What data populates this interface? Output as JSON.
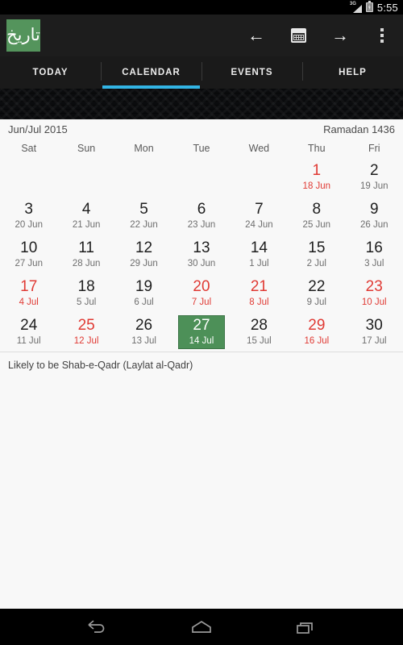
{
  "status_bar": {
    "network": "3G",
    "signal_icon": "signal-bars-icon",
    "battery_icon": "battery-charging-icon",
    "time": "5:55"
  },
  "action_bar": {
    "app_logo_text": "تاریخ",
    "app_logo_color": "#54945c",
    "buttons": [
      {
        "name": "previous-month-button",
        "glyph": "←"
      },
      {
        "name": "month-view-button",
        "glyph": "calendar-icon"
      },
      {
        "name": "next-month-button",
        "glyph": "→"
      },
      {
        "name": "overflow-menu-button",
        "glyph": "⋮"
      }
    ]
  },
  "tabs": {
    "active_index": 1,
    "accent_color": "#33b5e5",
    "items": [
      {
        "label": "TODAY"
      },
      {
        "label": "CALENDAR"
      },
      {
        "label": "EVENTS"
      },
      {
        "label": "HELP"
      }
    ]
  },
  "calendar": {
    "gregorian_range": "Jun/Jul 2015",
    "hijri_month": "Ramadan 1436",
    "weekday_headers": [
      "Sat",
      "Sun",
      "Mon",
      "Tue",
      "Wed",
      "Thu",
      "Fri"
    ],
    "selected_color": "#4d9058",
    "holiday_color": "#e03a34",
    "weeks": [
      [
        {
          "hijri": "",
          "greg": "",
          "empty": true
        },
        {
          "hijri": "",
          "greg": "",
          "empty": true
        },
        {
          "hijri": "",
          "greg": "",
          "empty": true
        },
        {
          "hijri": "",
          "greg": "",
          "empty": true
        },
        {
          "hijri": "",
          "greg": "",
          "empty": true
        },
        {
          "hijri": "1",
          "greg": "18 Jun",
          "holiday": true
        },
        {
          "hijri": "2",
          "greg": "19 Jun"
        }
      ],
      [
        {
          "hijri": "3",
          "greg": "20 Jun"
        },
        {
          "hijri": "4",
          "greg": "21 Jun"
        },
        {
          "hijri": "5",
          "greg": "22 Jun"
        },
        {
          "hijri": "6",
          "greg": "23 Jun"
        },
        {
          "hijri": "7",
          "greg": "24 Jun"
        },
        {
          "hijri": "8",
          "greg": "25 Jun"
        },
        {
          "hijri": "9",
          "greg": "26 Jun"
        }
      ],
      [
        {
          "hijri": "10",
          "greg": "27 Jun"
        },
        {
          "hijri": "11",
          "greg": "28 Jun"
        },
        {
          "hijri": "12",
          "greg": "29 Jun"
        },
        {
          "hijri": "13",
          "greg": "30 Jun"
        },
        {
          "hijri": "14",
          "greg": "1 Jul"
        },
        {
          "hijri": "15",
          "greg": "2 Jul"
        },
        {
          "hijri": "16",
          "greg": "3 Jul"
        }
      ],
      [
        {
          "hijri": "17",
          "greg": "4 Jul",
          "holiday": true
        },
        {
          "hijri": "18",
          "greg": "5 Jul"
        },
        {
          "hijri": "19",
          "greg": "6 Jul"
        },
        {
          "hijri": "20",
          "greg": "7 Jul",
          "holiday": true
        },
        {
          "hijri": "21",
          "greg": "8 Jul",
          "holiday": true
        },
        {
          "hijri": "22",
          "greg": "9 Jul"
        },
        {
          "hijri": "23",
          "greg": "10 Jul",
          "holiday": true
        }
      ],
      [
        {
          "hijri": "24",
          "greg": "11 Jul"
        },
        {
          "hijri": "25",
          "greg": "12 Jul",
          "holiday": true
        },
        {
          "hijri": "26",
          "greg": "13 Jul"
        },
        {
          "hijri": "27",
          "greg": "14 Jul",
          "selected": true
        },
        {
          "hijri": "28",
          "greg": "15 Jul"
        },
        {
          "hijri": "29",
          "greg": "16 Jul",
          "holiday": true
        },
        {
          "hijri": "30",
          "greg": "17 Jul"
        }
      ]
    ],
    "note": "Likely to be Shab-e-Qadr (Laylat al-Qadr)"
  },
  "nav_bar": {
    "buttons": [
      {
        "name": "back-button"
      },
      {
        "name": "home-button"
      },
      {
        "name": "recents-button"
      }
    ]
  }
}
